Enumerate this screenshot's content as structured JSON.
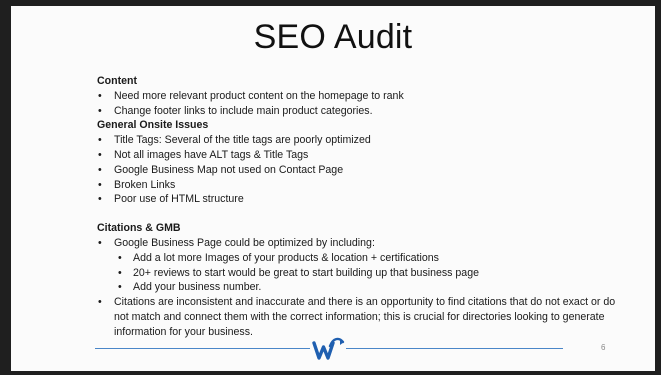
{
  "slide": {
    "title": "SEO Audit",
    "page_number": "6"
  },
  "content": {
    "heading": "Content",
    "items": [
      "Need more relevant product content on the homepage to rank",
      "Change footer links to include main product categories."
    ]
  },
  "onsite": {
    "heading": "General Onsite Issues",
    "items": [
      "Title Tags: Several of the title tags are poorly optimized",
      "Not all images have ALT tags & Title Tags",
      "Google Business Map not used on Contact Page",
      "Broken Links",
      "Poor use of HTML structure"
    ]
  },
  "citations": {
    "heading": "Citations & GMB",
    "gbp_item": "Google Business Page could be optimized by including:",
    "sub_items": [
      "Add a lot more Images of your products & location + certifications",
      "20+ reviews to start would be great to start building up that business page",
      "Add your business number."
    ],
    "last_item": "Citations are inconsistent and inaccurate and there is an opportunity to find citations that do not exact or do not match and connect them with the correct information; this is crucial for directories looking to generate information for your business."
  },
  "colors": {
    "accent": "#4a86c8",
    "logo": "#1f5fb0"
  },
  "logo": {
    "icon": "wave-w-logo-icon"
  }
}
